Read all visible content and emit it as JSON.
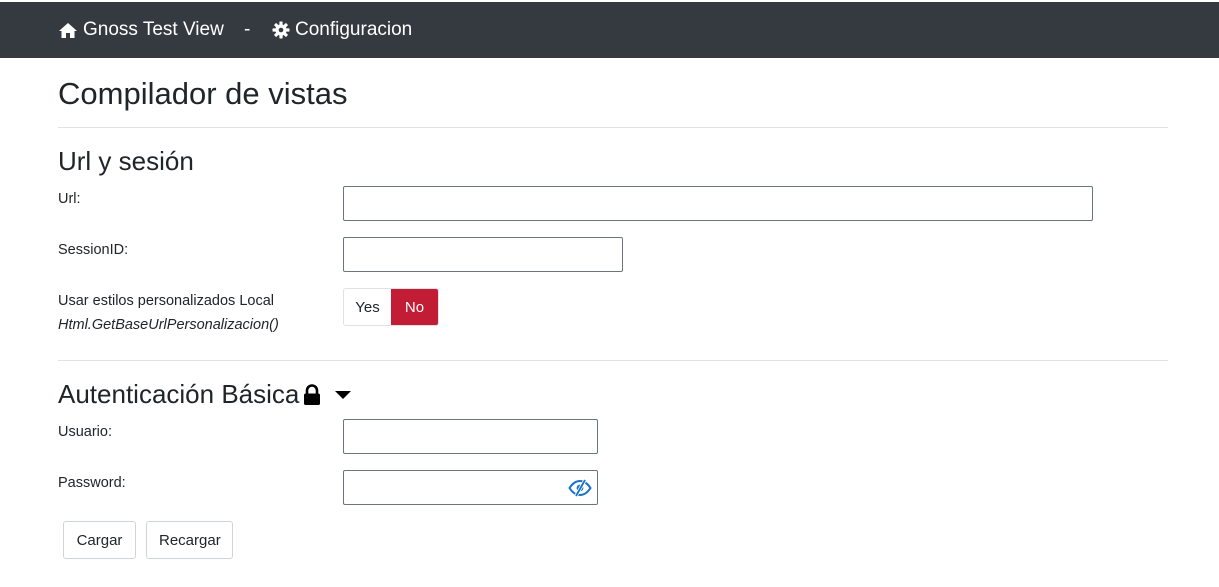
{
  "navbar": {
    "brand_label": "Gnoss Test View",
    "separator": "-",
    "config_label": "Configuracion",
    "background": "#343a40"
  },
  "page": {
    "title": "Compilador de vistas"
  },
  "url_section": {
    "heading": "Url y sesión",
    "url_label": "Url:",
    "url_value": "",
    "session_label": "SessionID:",
    "session_value": "",
    "styles_label": "Usar estilos personalizados Local",
    "styles_sublabel": "Html.GetBaseUrlPersonalizacion()",
    "toggle_yes": "Yes",
    "toggle_no": "No",
    "toggle_selected": "No",
    "active_color": "#c21d35"
  },
  "auth_section": {
    "heading": "Autenticación Básica",
    "user_label": "Usuario:",
    "user_value": "",
    "password_label": "Password:",
    "password_value": "",
    "eye_color": "#1a73c9"
  },
  "actions": {
    "load_label": "Cargar",
    "reload_label": "Recargar"
  },
  "icons": {
    "home": "home-icon",
    "gear": "gear-icon",
    "lock": "lock-icon",
    "caret": "caret-down-icon",
    "eye": "eye-slash-icon"
  }
}
